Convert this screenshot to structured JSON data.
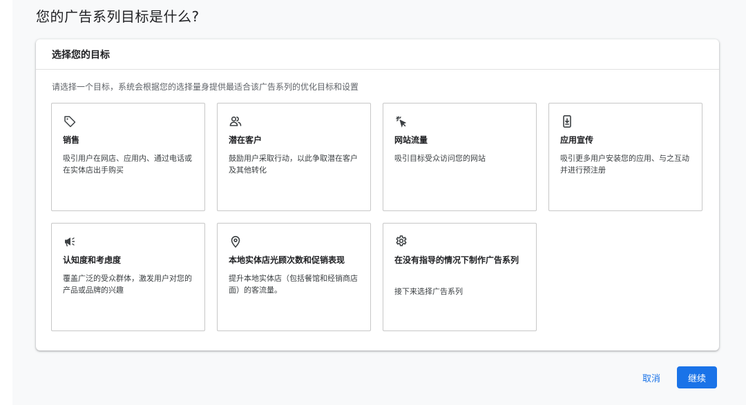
{
  "page": {
    "title": "您的广告系列目标是什么?"
  },
  "panel": {
    "header": "选择您的目标",
    "description": "请选择一个目标，系统会根据您的选择量身提供最适合该广告系列的优化目标和设置"
  },
  "goals": [
    {
      "icon": "tag-icon",
      "title": "销售",
      "desc": "吸引用户在网店、应用内、通过电话或在实体店出手购买"
    },
    {
      "icon": "people-icon",
      "title": "潜在客户",
      "desc": "鼓励用户采取行动，以此争取潜在客户及其他转化"
    },
    {
      "icon": "cursor-click-icon",
      "title": "网站流量",
      "desc": "吸引目标受众访问您的网站"
    },
    {
      "icon": "phone-download-icon",
      "title": "应用宣传",
      "desc": "吸引更多用户安装您的应用、与之互动并进行预注册"
    },
    {
      "icon": "megaphone-icon",
      "title": "认知度和考虑度",
      "desc": "覆盖广泛的受众群体，激发用户对您的产品或品牌的兴趣"
    },
    {
      "icon": "location-pin-icon",
      "title": "本地实体店光顾次数和促销表现",
      "desc": "提升本地实体店（包括餐馆和经销商店面）的客流量。"
    },
    {
      "icon": "gear-icon",
      "title": "在没有指导的情况下制作广告系列",
      "desc": "接下来选择广告系列"
    }
  ],
  "actions": {
    "cancel": "取消",
    "continue": "继续"
  },
  "colors": {
    "accent": "#1a73e8",
    "border": "#c7c7c7",
    "text": "#202124"
  }
}
